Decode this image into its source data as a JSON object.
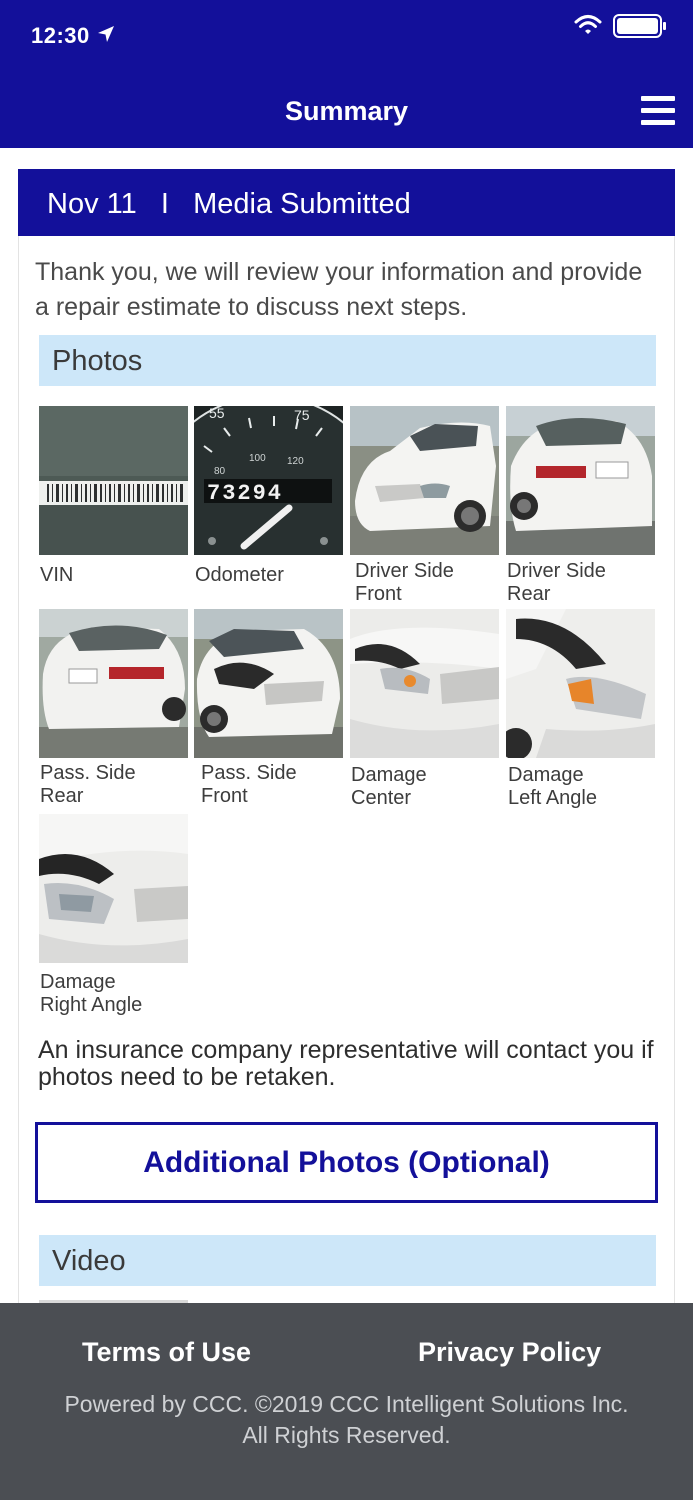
{
  "status_bar": {
    "time": "12:30"
  },
  "nav": {
    "title": "Summary"
  },
  "card": {
    "date": "Nov 11",
    "divider": "I",
    "status": "Media Submitted",
    "intro": "Thank you, we will review your information and provide a repair estimate to discuss next steps."
  },
  "photos": {
    "heading": "Photos",
    "items": [
      {
        "label": "VIN",
        "image": "vin-photo"
      },
      {
        "label": "Odometer",
        "image": "odometer-photo",
        "reading": "73294"
      },
      {
        "label": "Driver Side\nFront",
        "image": "car-photo"
      },
      {
        "label": "Driver Side\nRear",
        "image": "car-photo"
      },
      {
        "label": "Pass. Side\nRear",
        "image": "car-photo"
      },
      {
        "label": "Pass. Side\nFront",
        "image": "car-photo"
      },
      {
        "label": "Damage\nCenter",
        "image": "damage-photo"
      },
      {
        "label": "Damage\nLeft Angle",
        "image": "damage-photo"
      },
      {
        "label": "Damage\nRight Angle",
        "image": "damage-photo"
      }
    ]
  },
  "notice": "An insurance company representative will contact you if photos need to be retaken.",
  "additional_button": "Additional Photos (Optional)",
  "video": {
    "heading": "Video"
  },
  "footer": {
    "terms": "Terms of Use",
    "privacy": "Privacy Policy",
    "copyright": "Powered by CCC. ©2019 CCC Intelligent Solutions Inc.",
    "rights": "All Rights Reserved."
  },
  "colors": {
    "brand": "#13109a",
    "section_band": "#cde7f9",
    "footer": "#4b4e53"
  }
}
